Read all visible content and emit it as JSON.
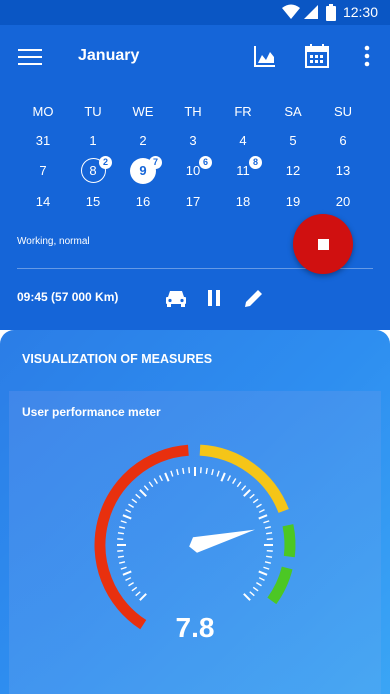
{
  "status_bar": {
    "time": "12:30"
  },
  "header": {
    "month": "January"
  },
  "calendar": {
    "weekdays": [
      "MO",
      "TU",
      "WE",
      "TH",
      "FR",
      "SA",
      "SU"
    ],
    "weeks": [
      [
        "31",
        "1",
        "2",
        "3",
        "4",
        "5",
        "6"
      ],
      [
        "7",
        "8",
        "9",
        "10",
        "11",
        "12",
        "13"
      ],
      [
        "14",
        "15",
        "16",
        "17",
        "18",
        "19",
        "20"
      ]
    ],
    "badges": {
      "8": "2",
      "9": "7",
      "10": "6",
      "11": "8"
    },
    "selected_day": "9",
    "ringed_day": "8"
  },
  "status_text": "Working, normal",
  "counter": "09:45 (57 000 Km)",
  "panel": {
    "title": "VISUALIZATION OF MEASURES",
    "card_title": "User performance meter",
    "meter_value": "7.8"
  },
  "meter": {
    "value": 7.8,
    "min": 0,
    "max": 10
  },
  "colors": {
    "appbar": "#1565d8",
    "fab": "#d01010",
    "red_arc": "#e8300e",
    "yellow_arc": "#f5c518",
    "green_arc": "#4cc724"
  }
}
